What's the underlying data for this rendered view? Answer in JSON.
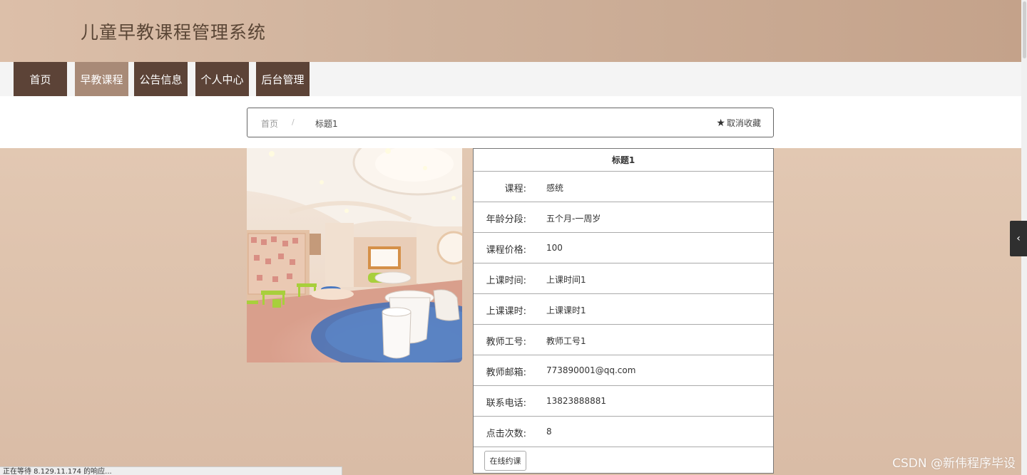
{
  "site": {
    "title": "儿童早教课程管理系统"
  },
  "nav": {
    "items": [
      {
        "label": "首页"
      },
      {
        "label": "早教课程"
      },
      {
        "label": "公告信息"
      },
      {
        "label": "个人中心"
      },
      {
        "label": "后台管理"
      }
    ],
    "active_index": 1
  },
  "breadcrumb": {
    "home": "首页",
    "separator": "/",
    "current": "标题1"
  },
  "favorite": {
    "label": "取消收藏",
    "icon": "star-icon"
  },
  "detail": {
    "title": "标题1",
    "rows": [
      {
        "label": "课程:",
        "value": "感统"
      },
      {
        "label": "年龄分段:",
        "value": "五个月-一周岁"
      },
      {
        "label": "课程价格:",
        "value": "100"
      },
      {
        "label": "上课时间:",
        "value": "上课时间1"
      },
      {
        "label": "上课课时:",
        "value": "上课课时1"
      },
      {
        "label": "教师工号:",
        "value": "教师工号1"
      },
      {
        "label": "教师邮箱:",
        "value": "773890001@qq.com"
      },
      {
        "label": "联系电话:",
        "value": "13823888881"
      },
      {
        "label": "点击次数:",
        "value": "8"
      }
    ],
    "book_button": "在线约课"
  },
  "status_bar": {
    "text": "正在等待 8.129.11.174 的响应..."
  },
  "watermark": {
    "text": "CSDN @新伟程序毕设"
  },
  "colors": {
    "nav_bg": "#5c4337",
    "nav_active": "#a88a77",
    "header_bg": "#c4a28a"
  }
}
